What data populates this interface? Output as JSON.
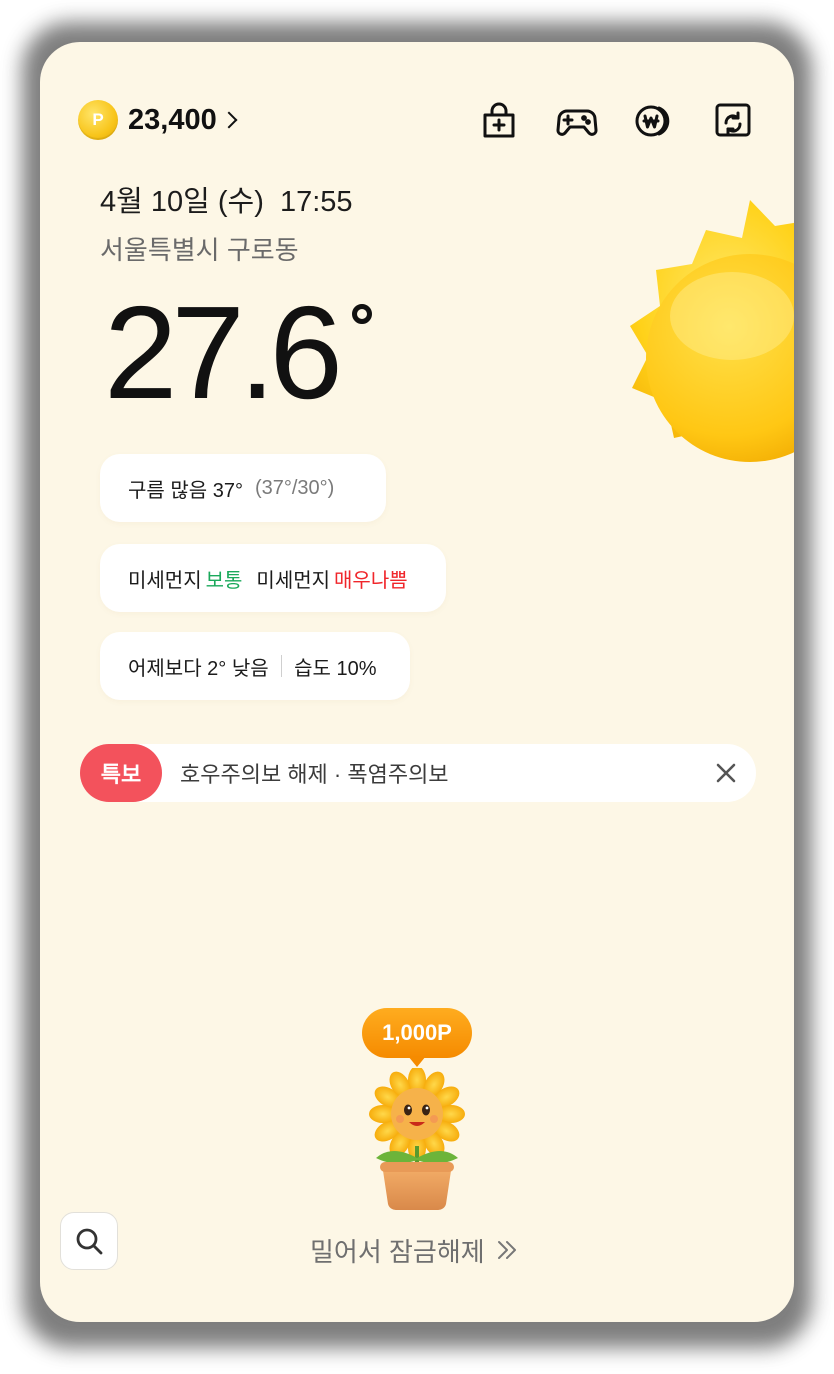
{
  "header": {
    "points_icon_letter": "P",
    "points_value": "23,400",
    "icons": [
      "shopping-bag-add-icon",
      "gamepad-icon",
      "won-coin-icon",
      "screen-rotate-icon"
    ]
  },
  "weather": {
    "datetime": "4월 10일 (수)  17:55",
    "location": "서울특별시 구로동",
    "temperature": "27.6",
    "condition": "구름 많음 37°",
    "high_low": "(37°/30°)",
    "fine_dust_label": "미세먼지",
    "fine_dust_value": "보통",
    "ultrafine_dust_label": "미세먼지",
    "ultrafine_dust_value": "매우나쁨",
    "compare_yesterday": "어제보다 2° 낮음",
    "humidity": "습도 10%"
  },
  "alert": {
    "badge": "특보",
    "text": "호우주의보 해제 · 폭염주의보"
  },
  "reward": {
    "points": "1,000P"
  },
  "footer": {
    "unlock_label": "밀어서 잠금해제"
  },
  "colors": {
    "background": "#fdf7e6",
    "good": "#1aa95b",
    "bad": "#f0262b",
    "alert_badge": "#f3525c",
    "reward": "#f58b00"
  }
}
